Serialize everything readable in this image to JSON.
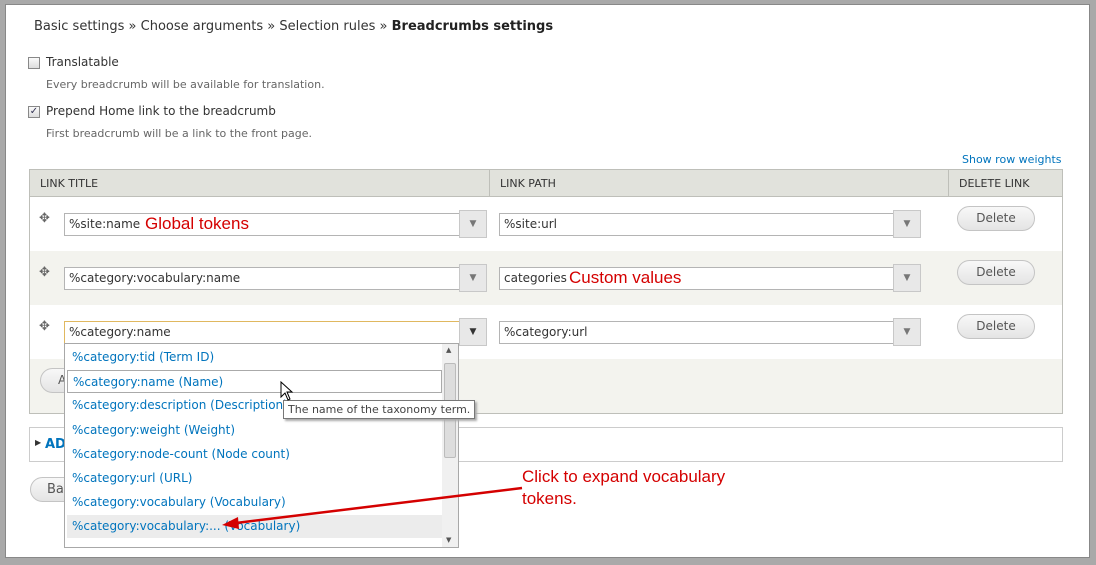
{
  "breadcrumb": {
    "items": [
      "Basic settings",
      "Choose arguments",
      "Selection rules"
    ],
    "separator": "»",
    "current": "Breadcrumbs settings"
  },
  "translatable": {
    "label": "Translatable",
    "checked": false,
    "description": "Every breadcrumb will be available for translation."
  },
  "prepend_home": {
    "label": "Prepend Home link to the breadcrumb",
    "checked": true,
    "description": "First breadcrumb will be a link to the front page."
  },
  "show_row_weights": "Show row weights",
  "table": {
    "headers": [
      "LINK TITLE",
      "LINK PATH",
      "DELETE LINK"
    ],
    "rows": [
      {
        "title": "%site:name",
        "path": "%site:url",
        "delete": "Delete"
      },
      {
        "title": "%category:vocabulary:name",
        "path": "categories",
        "delete": "Delete"
      },
      {
        "title": "%category:name",
        "path": "%category:url",
        "delete": "Delete"
      }
    ],
    "add_button": "A"
  },
  "advanced_label": "AD",
  "back_button": "Ba",
  "autocomplete": {
    "items": [
      "%category:tid (Term ID)",
      "%category:name (Name)",
      "%category:description (Description)",
      "%category:weight (Weight)",
      "%category:node-count (Node count)",
      "%category:url (URL)",
      "%category:vocabulary (Vocabulary)",
      "%category:vocabulary:... (Vocabulary)"
    ],
    "selected_index": 1,
    "tooltip": "The name of the taxonomy term."
  },
  "annotations": {
    "global": "Global tokens",
    "custom": "Custom values",
    "expand_1": "Click to expand vocabulary",
    "expand_2": "tokens."
  },
  "colors": {
    "link": "#0074bd",
    "annotation": "#d40000"
  }
}
